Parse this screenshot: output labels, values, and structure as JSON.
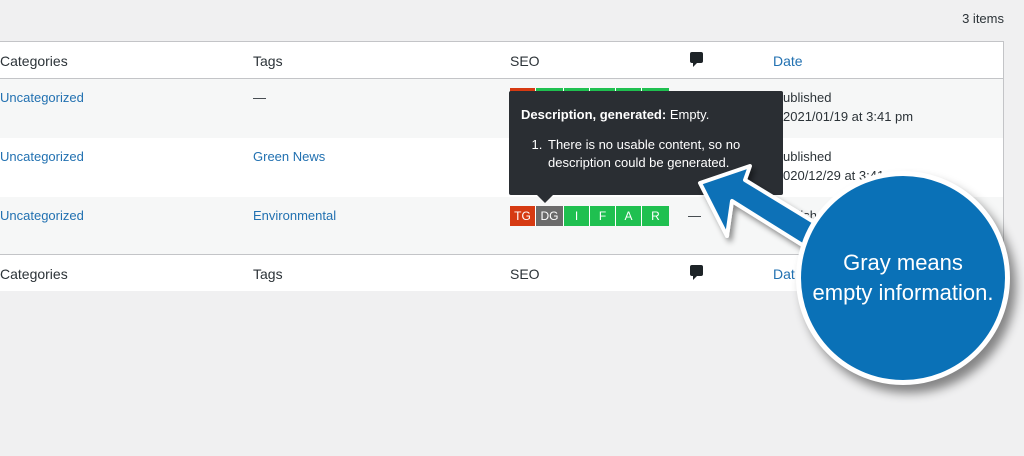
{
  "items_count": "3 items",
  "columns": {
    "categories": "Categories",
    "tags": "Tags",
    "seo": "SEO",
    "comments_icon": "comment-icon",
    "date": "Date"
  },
  "rows": [
    {
      "category": "Uncategorized",
      "tags": "—",
      "comments": "",
      "status": "ublished",
      "date": "2021/01/19 at 3:41 pm"
    },
    {
      "category": "Uncategorized",
      "tags": "Green News",
      "comments": "",
      "status": "ublished",
      "date": "020/12/29 at 3:41"
    },
    {
      "category": "Uncategorized",
      "tags": "Environmental",
      "comments": "—",
      "status": "ublished",
      "date": ""
    }
  ],
  "seo_segments": [
    "TG",
    "DG",
    "I",
    "F",
    "A",
    "R"
  ],
  "colors": {
    "red": "#d63a12",
    "gray": "#6b6b6b",
    "green": "#1fc050",
    "link": "#2271b1",
    "callout": "#0a71b7"
  },
  "tooltip": {
    "title": "Description, generated:",
    "status": "Empty.",
    "item": "There is no usable content, so no description could be generated."
  },
  "footer": {
    "date": "Dat"
  },
  "callout": {
    "text": "Gray means empty information."
  }
}
